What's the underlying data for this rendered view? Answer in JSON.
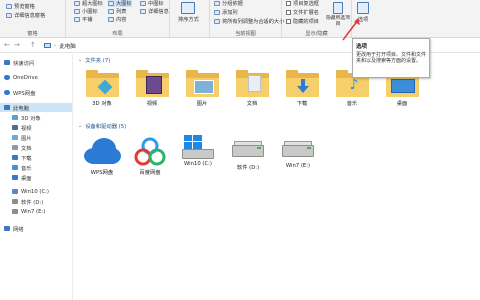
{
  "ribbon": {
    "group1_items": [
      "预览窗格",
      "详细信息窗格"
    ],
    "group1_label": "窗格",
    "layout_items": [
      "超大图标",
      "大图标",
      "中图标",
      "小图标",
      "列表",
      "详细信息",
      "平铺",
      "内容"
    ],
    "layout_label": "布局",
    "sort_label": "排序方式",
    "current_view_items": [
      "分组依据",
      "添加列",
      "将所有列调整为合适的大小"
    ],
    "current_view_label": "当前视图",
    "showhide_items": [
      "项目复选框",
      "文件扩展名",
      "隐藏的项目"
    ],
    "hide_selected_label": "隐藏所选项目",
    "showhide_label": "显示/隐藏",
    "options_label": "选项"
  },
  "address": {
    "back": "←",
    "forward": "→",
    "up": "↑",
    "path": "此电脑",
    "sep": "›"
  },
  "tooltip": {
    "title": "选项",
    "text": "更改用于打开项目、文件和文件夹和以及搜索等方面的设置。"
  },
  "sidebar": {
    "items": [
      {
        "label": "快速访问",
        "color": "#3b78c4"
      },
      {
        "label": "OneDrive",
        "color": "#2b7bd4"
      },
      {
        "label": "WPS网盘",
        "color": "#2b7bd4"
      },
      {
        "label": "此电脑",
        "color": "#3b78c4"
      },
      {
        "label": "3D 对象",
        "color": "#5aa0d8"
      },
      {
        "label": "视频",
        "color": "#5a6b8a"
      },
      {
        "label": "图片",
        "color": "#6aa8d8"
      },
      {
        "label": "文档",
        "color": "#8a9bb0"
      },
      {
        "label": "下载",
        "color": "#3b78c4"
      },
      {
        "label": "音乐",
        "color": "#4a90d8"
      },
      {
        "label": "桌面",
        "color": "#3b78c4"
      },
      {
        "label": "Win10 (C:)",
        "color": "#5a88c0"
      },
      {
        "label": "软件 (D:)",
        "color": "#8d8d8d"
      },
      {
        "label": "Win7 (E:)",
        "color": "#8d8d8d"
      },
      {
        "label": "网络",
        "color": "#3b78c4"
      }
    ]
  },
  "main": {
    "folders_header": "文件夹 (7)",
    "folders": [
      {
        "label": "3D 对象",
        "badge": "#3fa9d6"
      },
      {
        "label": "视频",
        "badge": "#6b4a8f"
      },
      {
        "label": "图片",
        "badge": "#7fb0d8"
      },
      {
        "label": "文档",
        "badge": "#e9eef3"
      },
      {
        "label": "下载",
        "badge": "#2b7bd4"
      },
      {
        "label": "音乐",
        "badge": "#2b8fd8"
      },
      {
        "label": "桌面",
        "badge": "#3a8fd8"
      }
    ],
    "devices_header": "设备和驱动器 (5)",
    "devices": [
      {
        "label": "WPS网盘",
        "kind": "cloud"
      },
      {
        "label": "百度网盘",
        "kind": "baidu"
      },
      {
        "label": "Win10 (C:)",
        "kind": "windows"
      },
      {
        "label": "软件 (D:)",
        "kind": "drive"
      },
      {
        "label": "Win7 (E:)",
        "kind": "drive"
      }
    ]
  },
  "colors": {
    "selection": "#cce4f7",
    "section_text": "#1a4e8c",
    "arrow": "#e53935"
  }
}
